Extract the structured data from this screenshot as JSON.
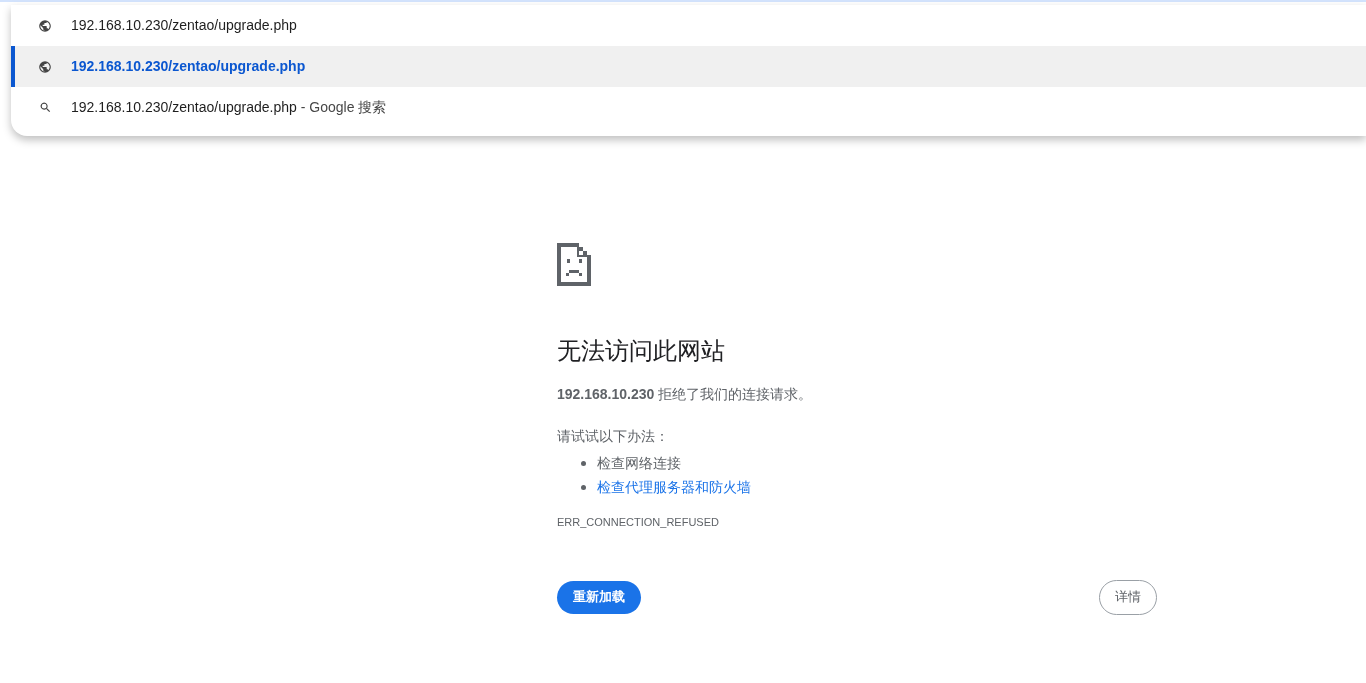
{
  "omnibox_suggestions": [
    {
      "kind": "url",
      "text": "192.168.10.230/zentao/upgrade.php",
      "selected": false
    },
    {
      "kind": "url",
      "text": "192.168.10.230/zentao/upgrade.php",
      "selected": true
    },
    {
      "kind": "search",
      "text": "192.168.10.230/zentao/upgrade.php",
      "suffix": "- Google 搜索",
      "selected": false
    }
  ],
  "error_page": {
    "title": "无法访问此网站",
    "message": "**192.168.10.230** 拒绝了我们的连接请求。",
    "suggestions_heading": "请试试以下办法：",
    "suggestions": [
      {
        "text": "检查网络连接",
        "link": false
      },
      {
        "text": "检查代理服务器和防火墙",
        "link": true
      }
    ],
    "error_code": "ERR_CONNECTION_REFUSED",
    "reload_button": "重新加载",
    "details_button": "详情"
  }
}
